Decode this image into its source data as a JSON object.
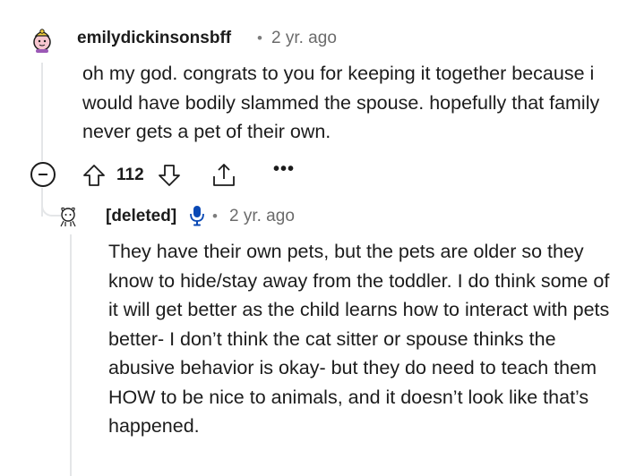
{
  "comments": [
    {
      "author": "emilydickinsonsbff",
      "separator": "•",
      "time": "2 yr. ago",
      "body": "oh my god. congrats to you for keeping it together because i would have bodily slammed the spouse. hopefully that family never gets a pet of their own.",
      "votes": "112",
      "more_label": "•••"
    },
    {
      "author": "[deleted]",
      "separator": "•",
      "time": "2 yr. ago",
      "body": "They have their own pets, but the pets are older so they know to hide/stay away from the toddler. I do think some of it will get better as the child learns how to interact with pets better- I don’t think the cat sitter or spouse thinks the abusive behavior is okay- but they do need to teach them HOW to be nice to animals, and it doesn’t look like that’s happened."
    }
  ],
  "colors": {
    "text": "#1c1c1c",
    "meta": "#6b6b6b",
    "thread": "#e4e6e8",
    "mic": "#0a49b5"
  },
  "icons": [
    "avatar-icon",
    "collapse-icon",
    "upvote-icon",
    "downvote-icon",
    "share-icon",
    "more-icon",
    "deleted-avatar-icon",
    "mic-icon"
  ]
}
